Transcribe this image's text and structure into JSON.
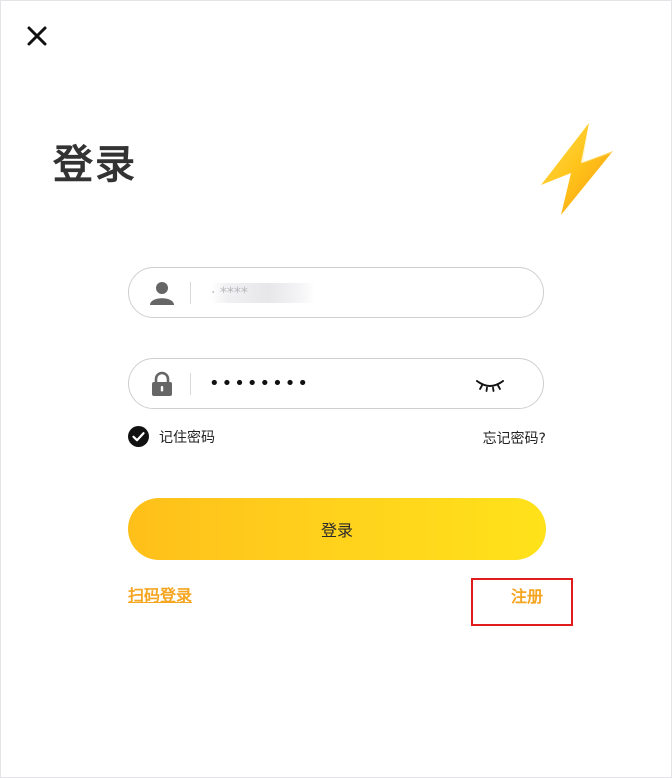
{
  "header": {
    "close_icon": "close-icon",
    "title": "登录"
  },
  "decoration": {
    "bolt_icon": "lightning-bolt-icon",
    "bolt_color": "#ffc21a"
  },
  "form": {
    "username": {
      "icon": "user-icon",
      "value": "·  ****"
    },
    "password": {
      "icon": "lock-icon",
      "value": "••••••••",
      "toggle_icon": "eye-closed-icon"
    },
    "remember": {
      "icon": "check-circle-icon",
      "label": "记住密码",
      "checked": true
    },
    "forgot_label": "忘记密码?",
    "login_button_label": "登录"
  },
  "footer": {
    "qr_login_label": "扫码登录",
    "register_label": "注册"
  },
  "colors": {
    "accent": "#f5a520",
    "button_start": "#ffbf1a",
    "button_end": "#ffe21a",
    "highlight": "#e01b1b"
  }
}
